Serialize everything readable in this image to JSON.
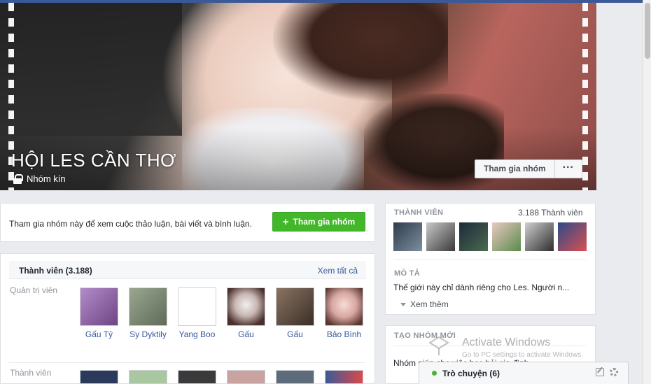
{
  "cover": {
    "title": "HỘI LES CẦN THƠ",
    "privacy": "Nhóm kín",
    "join_label": "Tham gia nhóm",
    "more_label": "···"
  },
  "join_panel": {
    "text": "Tham gia nhóm này để xem cuộc thảo luận, bài viết và bình luận.",
    "button": "Tham gia nhóm"
  },
  "members_panel": {
    "title": "Thành viên (3.188)",
    "see_all": "Xem tất cả",
    "admins_label": "Quản trị viên",
    "members_label": "Thành viên",
    "admins": [
      {
        "name": "Gấu Tỷ",
        "color": "#8a5fa8"
      },
      {
        "name": "Sy Dyktily",
        "color": "#7d8a76"
      },
      {
        "name": "Yang Boo",
        "color": "#ffffff"
      },
      {
        "name": "Gấu",
        "color": "#8c6b66"
      },
      {
        "name": "Gấu",
        "color": "#5c4a3e"
      },
      {
        "name": "Bảo Bình",
        "color": "#d9a9a4"
      }
    ]
  },
  "about": {
    "members_title": "THÀNH VIÊN",
    "members_count": "3.188 Thành viên",
    "description_title": "MÔ TẢ",
    "description": "Thế giới này chỉ dành riêng cho Les. Người n...",
    "see_more": "Xem thêm",
    "create_title": "TẠO NHÓM MỚI",
    "create_text": "Nhóm giúp cho việc học hỏi gia đình..."
  },
  "colors": {
    "brand": "#3b5998",
    "join_green": "#42b72a",
    "link": "#365899"
  },
  "watermark": {
    "title": "Activate Windows",
    "subtitle": "Go to PC settings to activate Windows."
  },
  "chat": {
    "label": "Trò chuyện (6)"
  }
}
